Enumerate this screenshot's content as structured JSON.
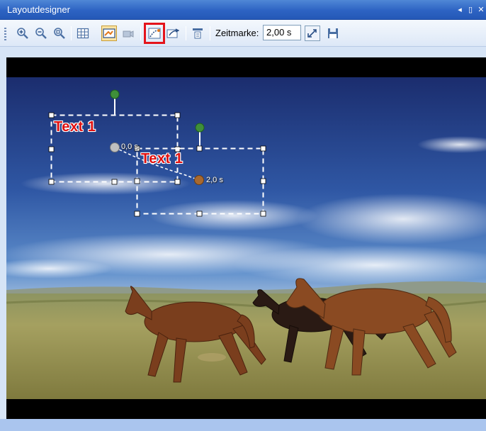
{
  "window": {
    "title": "Layoutdesigner",
    "controls": [
      "◂",
      "▯",
      "✕"
    ]
  },
  "toolbar": {
    "zeitmarke_label": "Zeitmarke:",
    "zeitmarke_value": "2,00 s",
    "buttons": [
      "zoom-in-icon",
      "zoom-out-icon",
      "zoom-fit-icon",
      "grid-icon",
      "layout-mode-icon",
      "camera-icon",
      "motion-path-icon",
      "motion-path-alt-icon",
      "align-icon",
      "set-keyframe-icon",
      "save-icon"
    ]
  },
  "canvas": {
    "objects": [
      {
        "text": "Text 1"
      },
      {
        "text": "Text 1"
      }
    ],
    "keyframes": [
      {
        "label": "0,0 s"
      },
      {
        "label": "2,0 s"
      }
    ]
  },
  "colors": {
    "title_bar": "#2d63c3",
    "text_object": "#e01010",
    "highlight": "#e4141b",
    "rotation_handle": "#3f8f3a",
    "keyframe_start": "#c0c0c0",
    "keyframe_end": "#a8692f"
  }
}
